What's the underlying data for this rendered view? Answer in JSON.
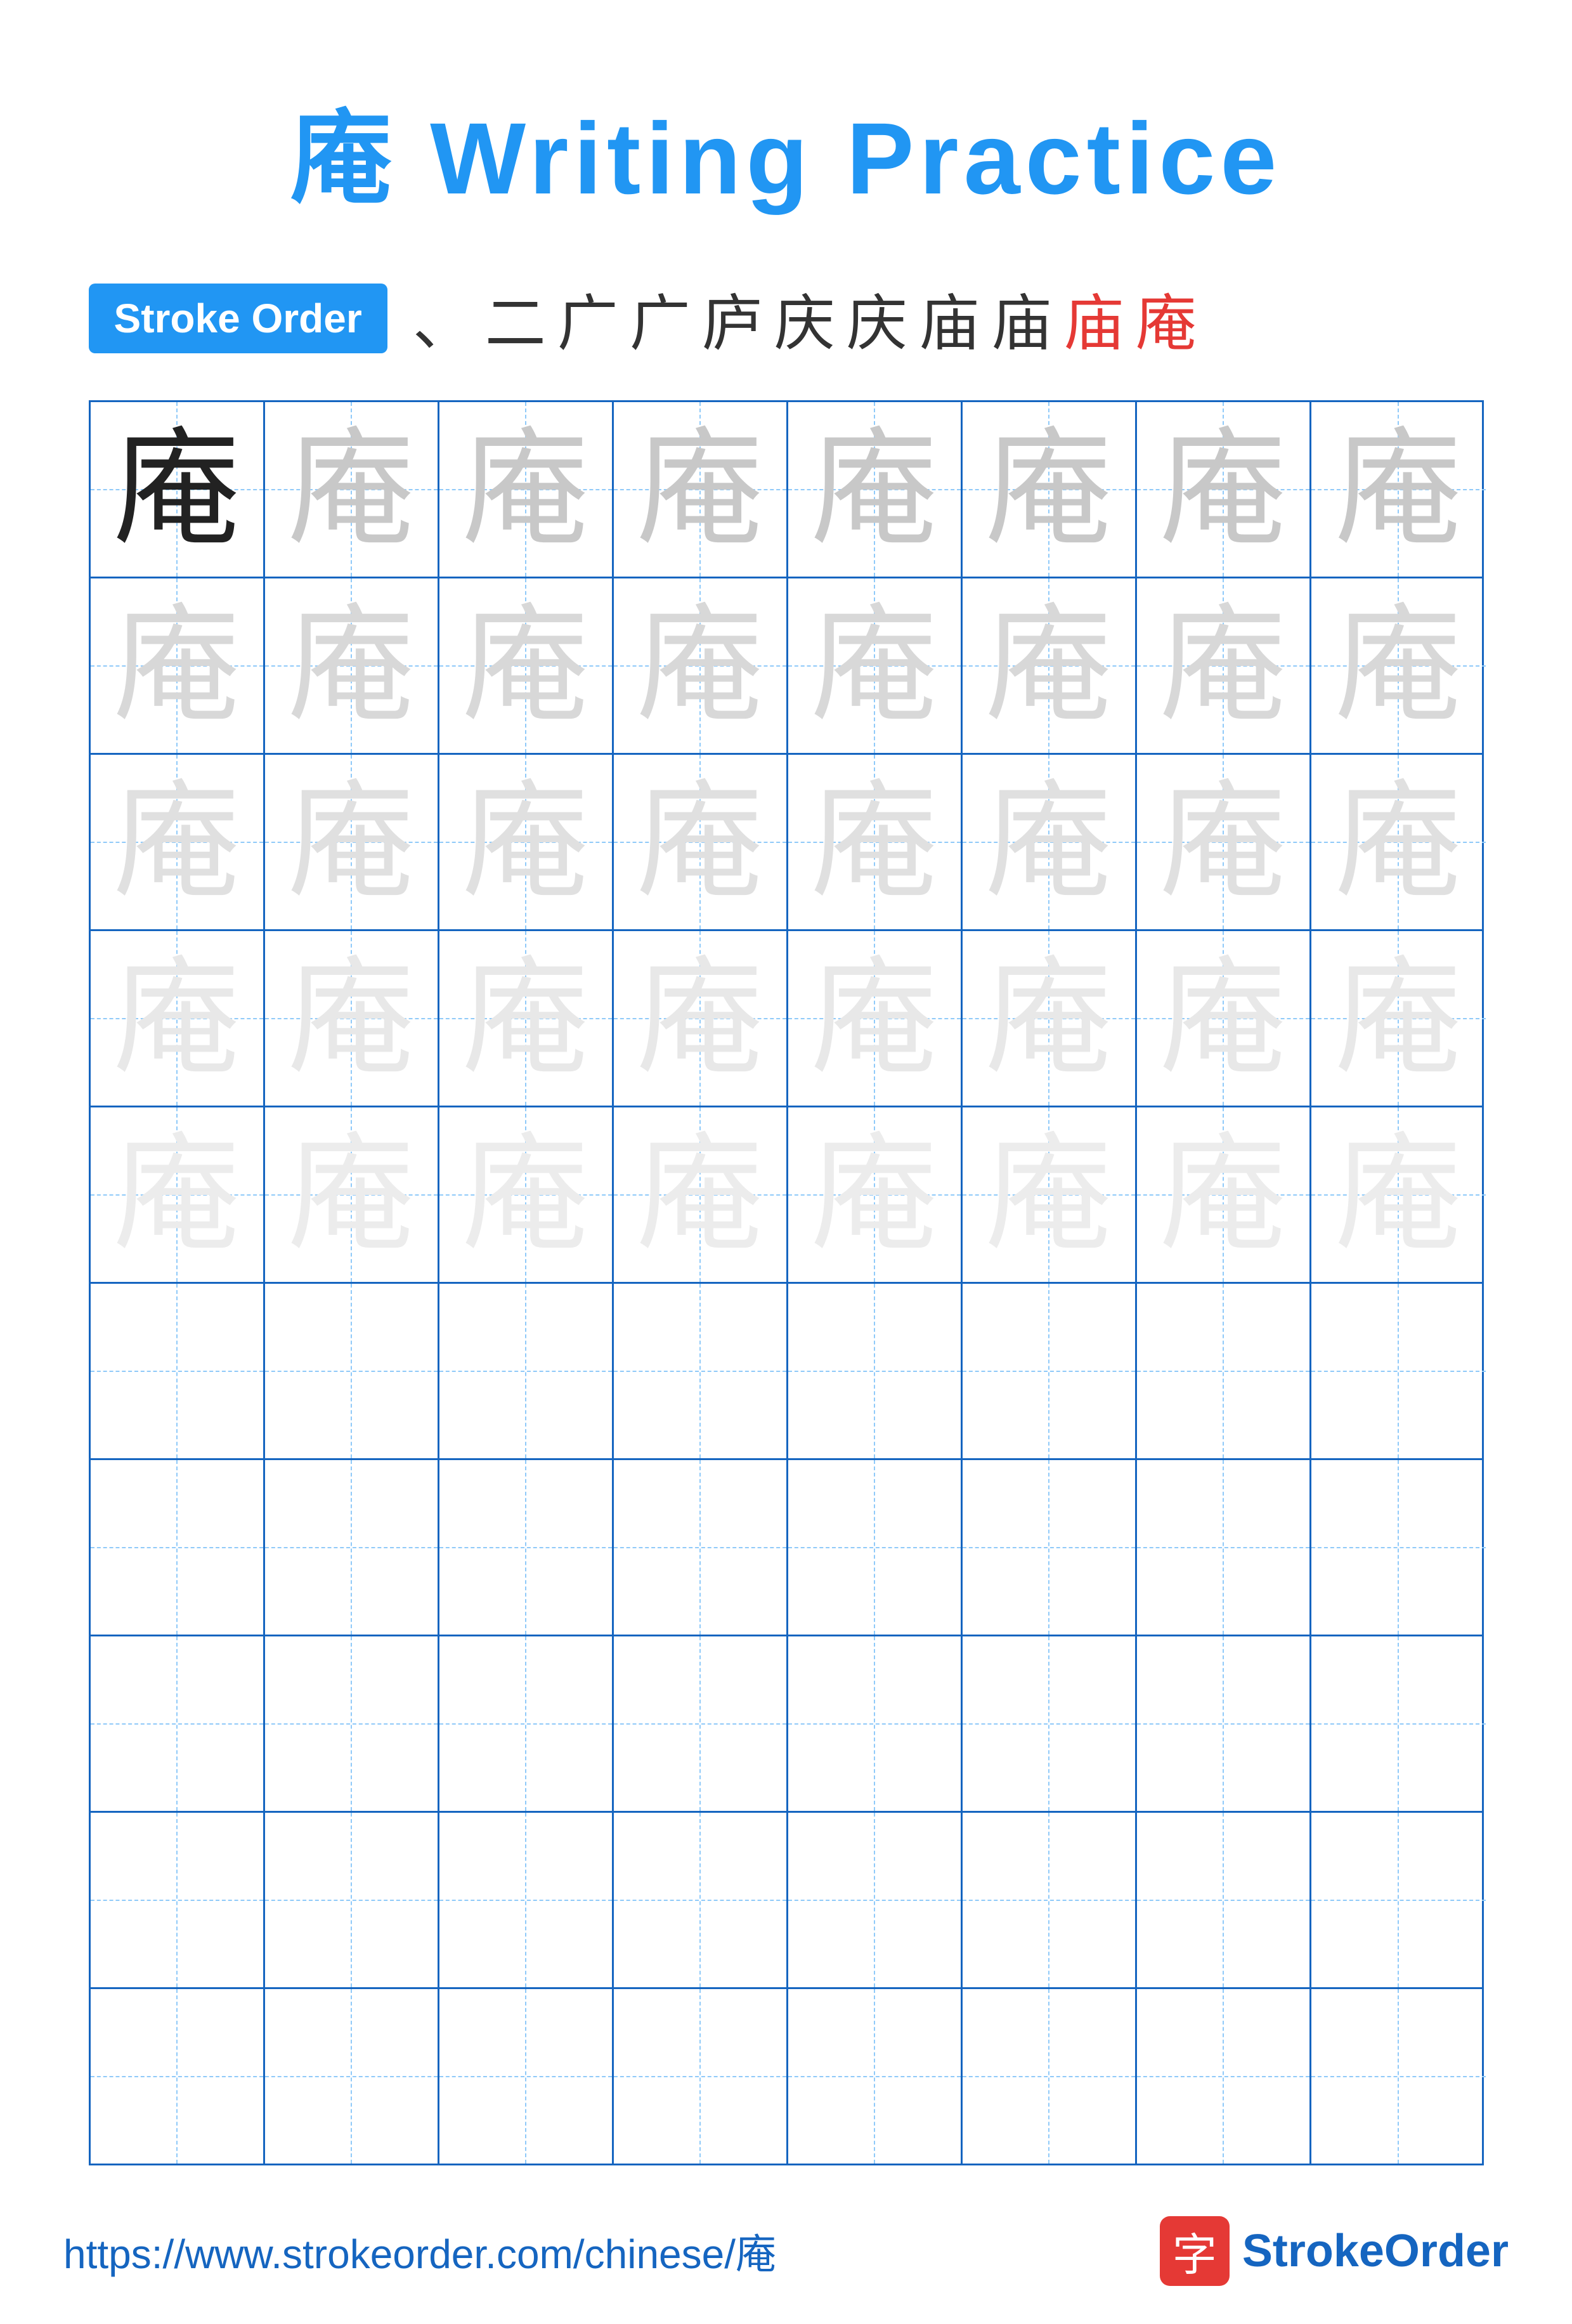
{
  "title": "庵 Writing Practice",
  "stroke_order_badge": "Stroke Order",
  "stroke_sequence": [
    "、",
    "二",
    "广",
    "广",
    "庐",
    "庆",
    "庆",
    "庙",
    "庙",
    "庙",
    "庵"
  ],
  "character": "庵",
  "grid": {
    "rows": 10,
    "cols": 8,
    "practice_rows": 5,
    "empty_rows": 5
  },
  "footer": {
    "url": "https://www.strokeorder.com/chinese/庵",
    "logo_char": "字",
    "logo_name": "StrokeOrder"
  }
}
